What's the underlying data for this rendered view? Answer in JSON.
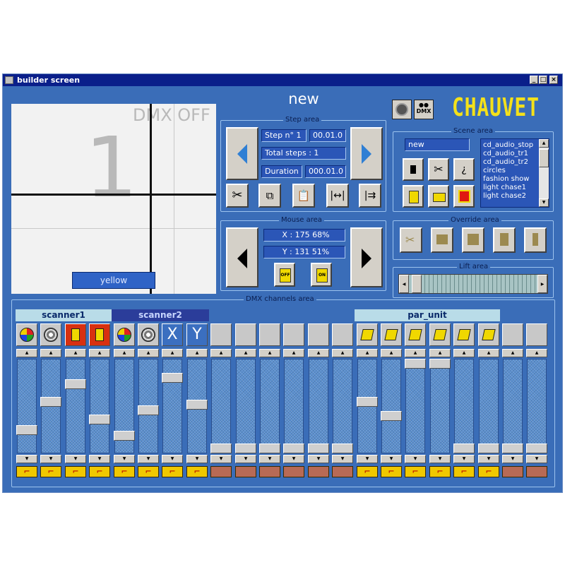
{
  "window": {
    "title": "builder screen"
  },
  "preview": {
    "dmx_status": "DMX OFF",
    "step_number": "1",
    "color_label": "yellow"
  },
  "scene_name_display": "new",
  "logo": {
    "text": "CHAUVET",
    "dmx_icon_label": "DMX"
  },
  "step_area": {
    "title": "Step area",
    "step_label": "Step n° 1",
    "step_time": "00.01.0",
    "total_steps": "Total steps : 1",
    "duration_label": "Duration",
    "duration_value": "000.01.0"
  },
  "mouse_area": {
    "title": "Mouse area",
    "x_readout": "X : 175   68%",
    "y_readout": "Y : 131   51%",
    "button_off_label": "OFF",
    "button_on_label": "ON"
  },
  "scene_area": {
    "title": "Scene area",
    "name_value": "new",
    "list": [
      "cd_audio_stop",
      "cd_audio_tr1",
      "cd_audio_tr2",
      "circles",
      "fashion show",
      "light chase1",
      "light chase2"
    ]
  },
  "override_area": {
    "title": "Override area"
  },
  "lift_area": {
    "title": "Lift area"
  },
  "dmx_area": {
    "title": "DMX channels area",
    "groups": [
      {
        "label": "scanner1"
      },
      {
        "label": "scanner2"
      },
      {
        "label": "par_unit"
      }
    ],
    "x_glyph": "X",
    "y_glyph": "Y",
    "channels": [
      {
        "icon": "color-wheel-icon",
        "level": 0.22
      },
      {
        "icon": "gobo-wheel-icon",
        "level": 0.55
      },
      {
        "icon": "shutter-red-icon",
        "level": 0.76
      },
      {
        "icon": "dimmer-red-icon",
        "level": 0.34
      },
      {
        "icon": "color-wheel-icon",
        "level": 0.15
      },
      {
        "icon": "gobo-wheel-icon",
        "level": 0.45
      },
      {
        "icon": "pan-x-icon",
        "level": 0.83
      },
      {
        "icon": "tilt-y-icon",
        "level": 0.52
      },
      {
        "icon": "none",
        "level": 0.0
      },
      {
        "icon": "none",
        "level": 0.0
      },
      {
        "icon": "none",
        "level": 0.0
      },
      {
        "icon": "none",
        "level": 0.0
      },
      {
        "icon": "none",
        "level": 0.0
      },
      {
        "icon": "none",
        "level": 0.0
      },
      {
        "icon": "par-light-icon",
        "level": 0.55
      },
      {
        "icon": "par-light-icon",
        "level": 0.38
      },
      {
        "icon": "par-light-icon",
        "level": 1.0
      },
      {
        "icon": "par-light-icon",
        "level": 1.0
      },
      {
        "icon": "par-light-icon",
        "level": 0.0
      },
      {
        "icon": "par-light-icon",
        "level": 0.0
      },
      {
        "icon": "none",
        "level": 0.0
      },
      {
        "icon": "none",
        "level": 0.0
      }
    ],
    "modes": [
      "step",
      "step",
      "step",
      "step",
      "step",
      "step",
      "step",
      "step",
      "fade",
      "fade",
      "fade",
      "fade",
      "fade",
      "fade",
      "step",
      "step",
      "step",
      "step",
      "step",
      "step",
      "fade",
      "fade"
    ]
  },
  "colors": {
    "window_bg": "#3a6db8",
    "title_bar": "#0a1f8a",
    "field_bg": "#2b56b7",
    "logo_yellow": "#f4e11a",
    "mode_step": "#f0c800",
    "mode_fade": "#b86a55"
  }
}
